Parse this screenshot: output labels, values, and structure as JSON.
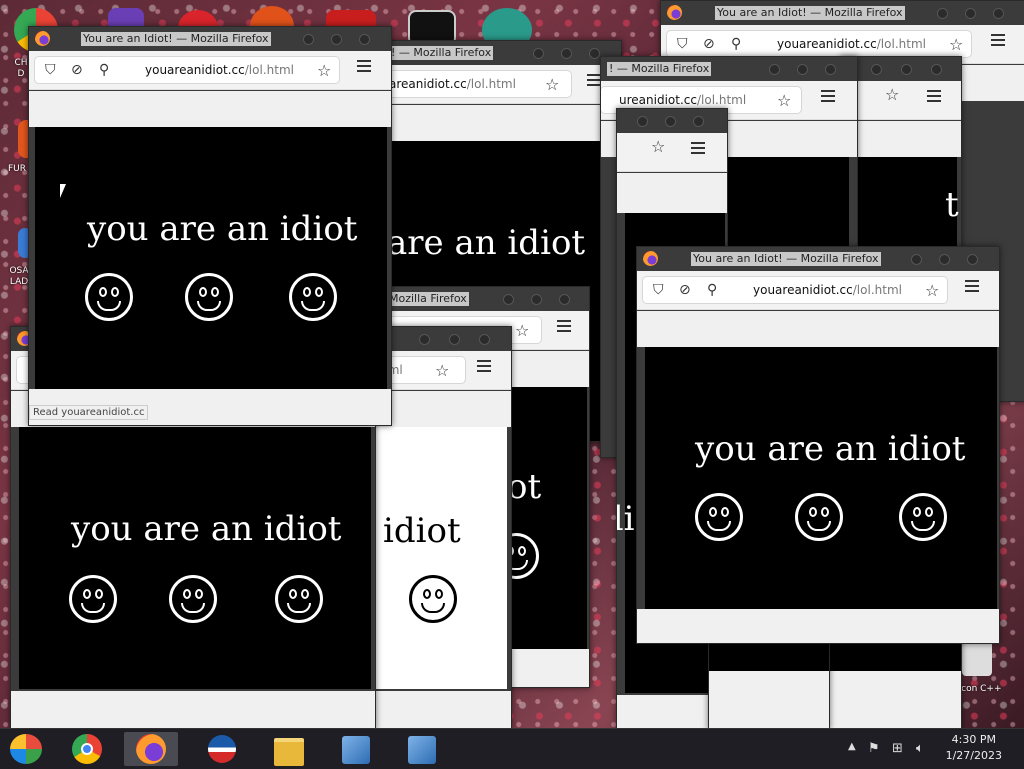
{
  "desktop": {
    "icons": [
      {
        "label": "CH D"
      },
      {
        "label": "FUR"
      },
      {
        "label": "OSA LAD"
      },
      {
        "label": "Icon C++"
      }
    ]
  },
  "windows": {
    "title": "You are an Idiot! — Mozilla Firefox",
    "title_partial": "! — Mozilla Firefox",
    "title_mozilla": "Mozilla Firefox",
    "url_domain": "youareanidiot.cc",
    "url_path": "/lol.html",
    "url_partial_domain": "areanidiot.cc",
    "url_partial_domain2": "ureanidiot.cc",
    "url_partial_path": "tml",
    "message": "you are an idiot",
    "message_crop1": "are an idiot",
    "message_crop2": "idiot",
    "message_crop3": "ot",
    "message_crop4": "idi",
    "status": "Read youareanidiot.cc",
    "icons": {
      "shield": "shield-icon",
      "lock": "lock-off-icon",
      "star": "star-icon",
      "menu": "menu-icon"
    }
  },
  "taskbar": {
    "apps": [
      "windows-start",
      "chrome",
      "firefox",
      "obama-logo",
      "file-explorer",
      "installer-1",
      "installer-2"
    ],
    "time": "4:30 PM",
    "date": "1/27/2023"
  }
}
